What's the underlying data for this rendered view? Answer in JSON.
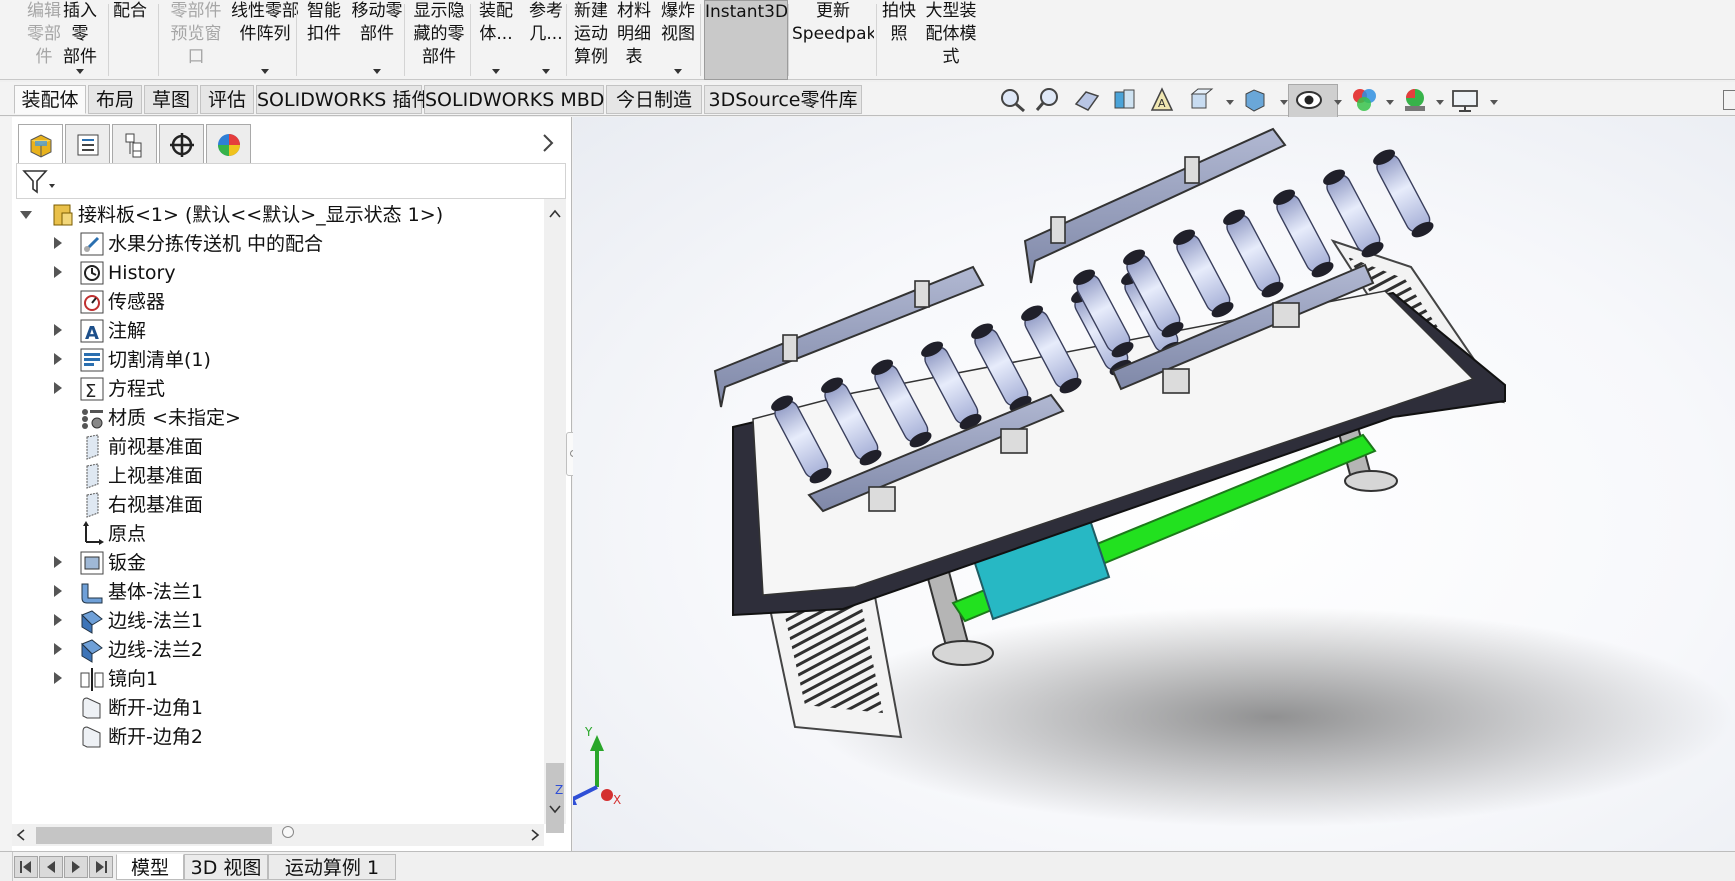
{
  "ribbon": {
    "buttons": [
      {
        "id": "edit-component",
        "label": "编辑\n零部\n件",
        "disabled": true
      },
      {
        "id": "insert-components",
        "label": "插入零\n部件",
        "disabled": false,
        "dropdown": true
      },
      {
        "id": "mate",
        "label": "配合",
        "disabled": false
      },
      {
        "id": "component-preview",
        "label": "零部件\n预览窗\n口",
        "disabled": true
      },
      {
        "id": "linear-pattern",
        "label": "线性零部\n件阵列",
        "disabled": false,
        "dropdown": true
      },
      {
        "id": "smart-fasteners",
        "label": "智能\n扣件",
        "disabled": false
      },
      {
        "id": "move-component",
        "label": "移动零\n部件",
        "disabled": false,
        "dropdown": true
      },
      {
        "id": "show-hidden",
        "label": "显示隐\n藏的零\n部件",
        "disabled": false
      },
      {
        "id": "assembly-features",
        "label": "装配\n体...",
        "disabled": false,
        "dropdown": true
      },
      {
        "id": "reference-geometry",
        "label": "参考\n几...",
        "disabled": false,
        "dropdown": true
      },
      {
        "id": "new-motion-study",
        "label": "新建\n运动\n算例",
        "disabled": false
      },
      {
        "id": "bill-of-materials",
        "label": "材料\n明细\n表",
        "disabled": false
      },
      {
        "id": "exploded-view",
        "label": "爆炸\n视图",
        "disabled": false,
        "dropdown": true
      },
      {
        "id": "instant3d",
        "label": "Instant3D",
        "disabled": false,
        "active": true
      },
      {
        "id": "update-speedpak",
        "label": "更新\nSpeedpak",
        "disabled": false
      },
      {
        "id": "take-snapshot",
        "label": "拍快\n照",
        "disabled": false
      },
      {
        "id": "large-assembly",
        "label": "大型装\n配体模\n式",
        "disabled": false
      }
    ]
  },
  "command_tabs": [
    "装配体",
    "布局",
    "草图",
    "评估",
    "SOLIDWORKS 插件",
    "SOLIDWORKS MBD",
    "今日制造",
    "3DSource零件库"
  ],
  "command_tabs_active": 0,
  "heads_up_icons": [
    "zoom-to-fit-icon",
    "zoom-to-area-icon",
    "previous-view-icon",
    "section-view-icon",
    "dynamic-annotation-icon",
    "view-orientation-icon",
    "display-style-icon",
    "hide-show-items-icon",
    "edit-appearance-icon",
    "apply-scene-icon",
    "view-settings-icon"
  ],
  "panel_tabs": [
    "featuremanager-icon",
    "propertymanager-icon",
    "configurationmanager-icon",
    "dimxpertmanager-icon",
    "displaymanager-icon"
  ],
  "tree": {
    "root": "接料板<1> (默认<<默认>_显示状态 1>)",
    "items": [
      {
        "label": "水果分拣传送机 中的配合",
        "icon": "mates-icon",
        "expandable": true
      },
      {
        "label": "History",
        "icon": "history-icon",
        "expandable": true
      },
      {
        "label": "传感器",
        "icon": "sensors-icon",
        "expandable": false
      },
      {
        "label": "注解",
        "icon": "annotations-icon",
        "expandable": true
      },
      {
        "label": "切割清单(1)",
        "icon": "cut-list-icon",
        "expandable": true
      },
      {
        "label": "方程式",
        "icon": "equations-icon",
        "expandable": true
      },
      {
        "label": "材质 <未指定>",
        "icon": "material-icon",
        "expandable": false
      },
      {
        "label": "前视基准面",
        "icon": "plane-icon",
        "expandable": false
      },
      {
        "label": "上视基准面",
        "icon": "plane-icon",
        "expandable": false
      },
      {
        "label": "右视基准面",
        "icon": "plane-icon",
        "expandable": false
      },
      {
        "label": "原点",
        "icon": "origin-icon",
        "expandable": false
      },
      {
        "label": "钣金",
        "icon": "sheet-metal-icon",
        "expandable": true
      },
      {
        "label": "基体-法兰1",
        "icon": "base-flange-icon",
        "expandable": true
      },
      {
        "label": "边线-法兰1",
        "icon": "edge-flange-icon",
        "expandable": true
      },
      {
        "label": "边线-法兰2",
        "icon": "edge-flange-icon",
        "expandable": true
      },
      {
        "label": "镜向1",
        "icon": "mirror-icon",
        "expandable": true
      },
      {
        "label": "断开-边角1",
        "icon": "break-corner-icon",
        "expandable": false
      },
      {
        "label": "断开-边角2",
        "icon": "break-corner-icon",
        "expandable": false
      }
    ]
  },
  "triad": {
    "x": "X",
    "y": "Y",
    "z": "Z"
  },
  "bottom_tabs": [
    "模型",
    "3D 视图",
    "运动算例 1"
  ],
  "bottom_tabs_active": 0,
  "colors": {
    "roller": "#c9d2ee",
    "guide": "#9aa3c0",
    "frame": "#2e2e3a",
    "green": "#22e11f",
    "teal": "#27b8c4",
    "sheet": "#f2f2f2"
  }
}
